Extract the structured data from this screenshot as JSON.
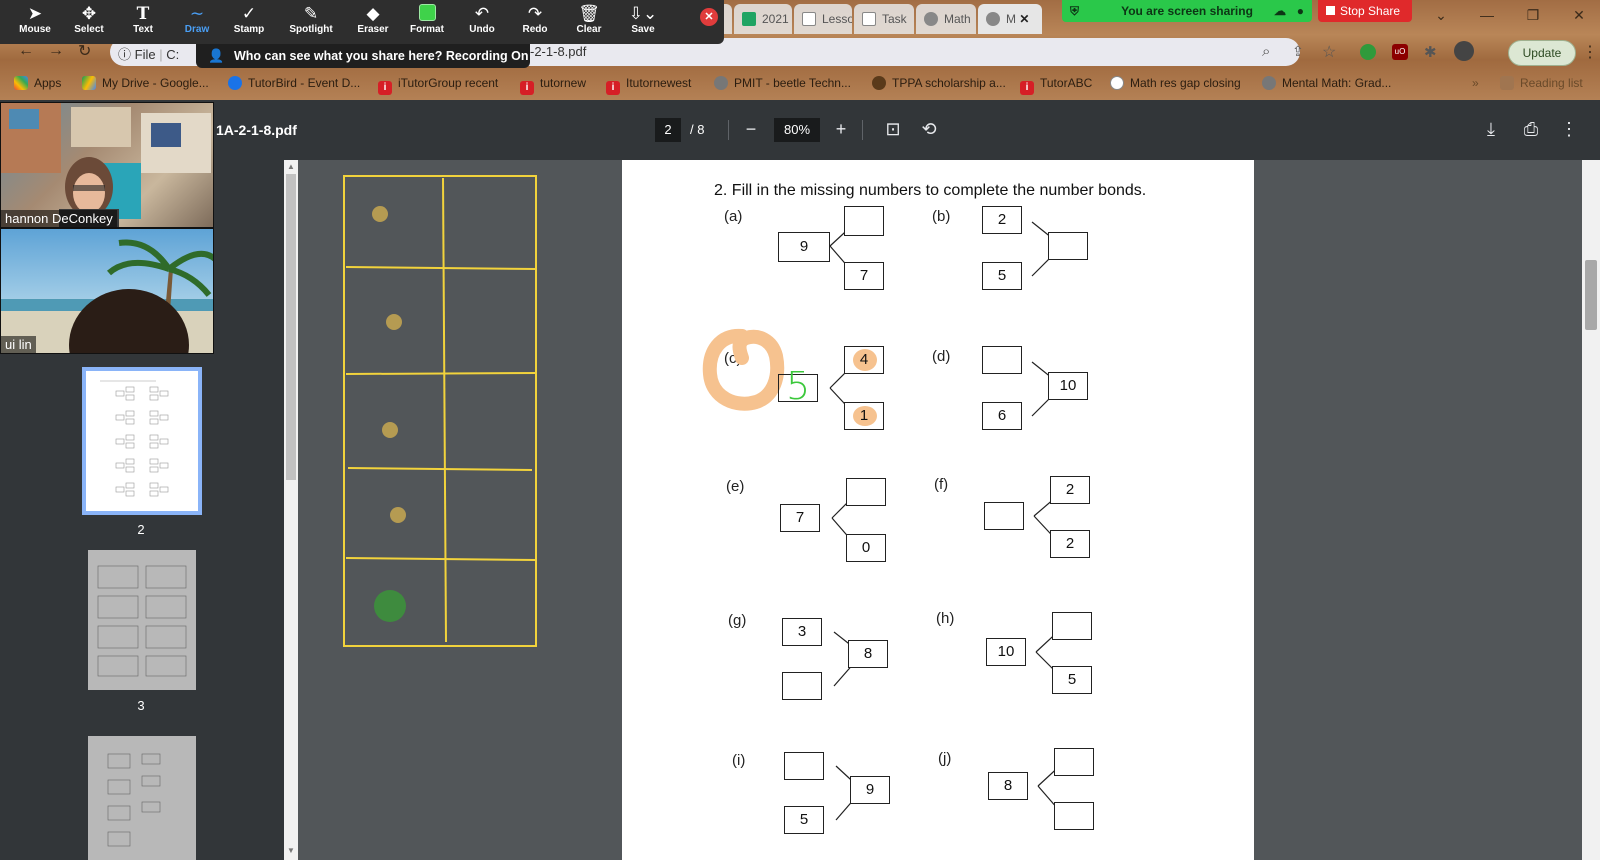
{
  "zoom_toolbar": {
    "tools": [
      {
        "label": "Mouse",
        "icon": "mouse-pointer-icon"
      },
      {
        "label": "Select",
        "icon": "select-move-icon"
      },
      {
        "label": "Text",
        "icon": "text-icon"
      },
      {
        "label": "Draw",
        "icon": "draw-squiggle-icon"
      },
      {
        "label": "Stamp",
        "icon": "stamp-check-icon"
      },
      {
        "label": "Spotlight",
        "icon": "spotlight-wand-icon"
      },
      {
        "label": "Eraser",
        "icon": "eraser-icon"
      },
      {
        "label": "Format",
        "icon": "format-color-icon"
      },
      {
        "label": "Undo",
        "icon": "undo-icon"
      },
      {
        "label": "Redo",
        "icon": "redo-icon"
      },
      {
        "label": "Clear",
        "icon": "trash-icon"
      },
      {
        "label": "Save",
        "icon": "save-download-icon"
      }
    ],
    "active_tool": "Draw",
    "active_color": "#4a9ff5",
    "format_color": "#3fd24a",
    "tooltip": "Who can see what you share here? Recording On"
  },
  "screen_share": {
    "status": "You are screen sharing",
    "stop_label": "Stop Share"
  },
  "browser": {
    "tabs": [
      "2021",
      "Lesso",
      "Task",
      "Math",
      "M"
    ],
    "address": "-2-1-8.pdf",
    "site_label": "File",
    "update_label": "Update",
    "bookmarks": [
      "Apps",
      "My Drive - Google...",
      "TutorBird - Event D...",
      "iTutorGroup recent",
      "tutornew",
      "Itutornewest",
      "PMIT - beetle Techn...",
      "TPPA scholarship a...",
      "TutorABC",
      "Math res gap closing",
      "Mental Math: Grad..."
    ],
    "reading_list": "Reading list"
  },
  "pdf_viewer": {
    "title": "1A-2-1-8.pdf",
    "current_page": "2",
    "total_pages": "/ 8",
    "zoom": "80%"
  },
  "sidebar": {
    "participants": [
      "hannon DeConkey",
      "ui lin"
    ],
    "thumb_labels": [
      "2",
      "3"
    ]
  },
  "worksheet": {
    "question": "2.  Fill in the missing numbers to complete the number bonds.",
    "labels": [
      "(a)",
      "(b)",
      "(c)",
      "(d)",
      "(e)",
      "(f)",
      "(g)",
      "(h)",
      "(i)",
      "(j)"
    ],
    "a": {
      "whole": "9",
      "part1": "",
      "part2": "7"
    },
    "b": {
      "part1": "2",
      "part2": "5",
      "whole": ""
    },
    "c": {
      "whole": "",
      "part1": "4",
      "part2": "1",
      "handwritten": "5"
    },
    "d": {
      "part1": "",
      "part2": "6",
      "whole": "10"
    },
    "e": {
      "whole": "7",
      "part1": "",
      "part2": "0"
    },
    "f": {
      "whole": "",
      "part1": "2",
      "part2": "2"
    },
    "g": {
      "part1": "3",
      "part2": "",
      "whole": "8"
    },
    "h": {
      "whole": "10",
      "part1": "",
      "part2": "5"
    },
    "i": {
      "part1": "",
      "part2": "5",
      "whole": "9"
    },
    "j": {
      "whole": "8",
      "part1": "",
      "part2": ""
    }
  },
  "ten_frame": {
    "filled_counters": 5,
    "counter_color": "#b59b52",
    "last_counter_color": "#3e8b3e",
    "frame_color": "#f2d33c"
  },
  "annotation_colors": {
    "circle": "#f6c28f",
    "handwriting": "#3cc83c"
  }
}
